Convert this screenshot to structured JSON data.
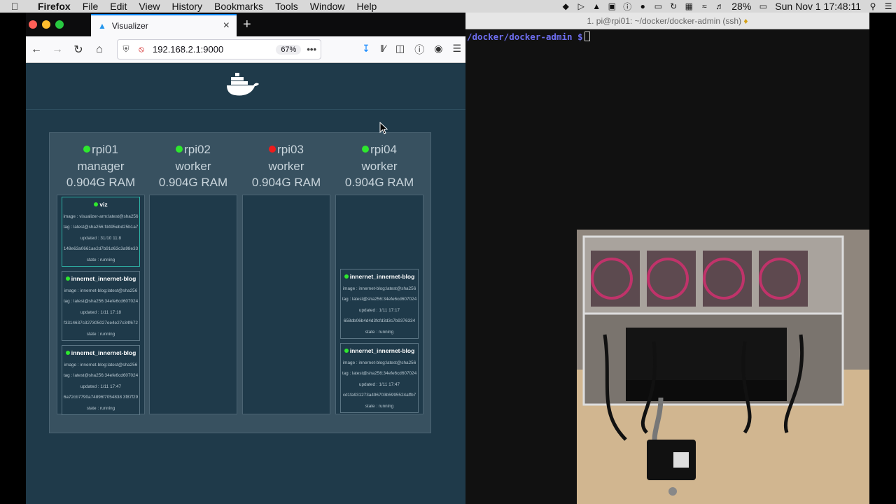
{
  "menubar": {
    "app_name": "Firefox",
    "items": [
      "File",
      "Edit",
      "View",
      "History",
      "Bookmarks",
      "Tools",
      "Window",
      "Help"
    ],
    "battery": "28%",
    "clock": "Sun Nov 1  17:48:11"
  },
  "browser": {
    "tab_title": "Visualizer",
    "url": "192.168.2.1:9000",
    "zoom": "67%"
  },
  "nodes": [
    {
      "name": "rpi01",
      "role": "manager",
      "ram": "0.904G RAM",
      "status": "up",
      "containers": [
        {
          "name": "viz",
          "image": "image : visualizer-arm:latest@sha256",
          "tag": "tag : latest@sha256:fd495ebd25b1a7",
          "updated": "updated : 31/10 11:8",
          "id": "148e63a0661ae2d7b91d63c3a98e33",
          "state": "state : running",
          "highlight": true
        },
        {
          "name": "innernet_innernet-blog",
          "image": "image : innernet-blog:latest@sha256",
          "tag": "tag : latest@sha256:34efe6cd607024",
          "updated": "updated : 1/11 17:18",
          "id": "f3314637c327305027ee4e27c34f672",
          "state": "state : running",
          "highlight": false
        },
        {
          "name": "innernet_innernet-blog",
          "image": "image : innernet-blog:latest@sha256",
          "tag": "tag : latest@sha256:34efe6cd607024",
          "updated": "updated : 1/11 17:47",
          "id": "6a72cb7790a74896f7054838 3f87f29",
          "state": "state : running",
          "highlight": false
        }
      ]
    },
    {
      "name": "rpi02",
      "role": "worker",
      "ram": "0.904G RAM",
      "status": "up",
      "containers": []
    },
    {
      "name": "rpi03",
      "role": "worker",
      "ram": "0.904G RAM",
      "status": "down",
      "containers": []
    },
    {
      "name": "rpi04",
      "role": "worker",
      "ram": "0.904G RAM",
      "status": "up",
      "containers": [
        {
          "name": "innernet_innernet-blog",
          "image": "image : innernet-blog:latest@sha256",
          "tag": "tag : latest@sha256:34efe6cd607024",
          "updated": "updated : 1/11 17:17",
          "id": "658db06b4d4d3fcfd3d3c7b9376334",
          "state": "state : running",
          "highlight": false
        },
        {
          "name": "innernet_innernet-blog",
          "image": "image : innernet-blog:latest@sha256",
          "tag": "tag : latest@sha256:34efe6cd607024",
          "updated": "updated : 1/11 17:47",
          "id": "cd1fa931273a496703b5995524affb7",
          "state": "state : running",
          "highlight": false
        }
      ]
    }
  ],
  "terminal": {
    "title": "1. pi@rpi01: ~/docker/docker-admin (ssh)",
    "prompt": "/docker/docker-admin $"
  },
  "colors": {
    "page_bg": "#1f3a4a",
    "node_up": "#2ee72e",
    "node_down": "#ee1c1c",
    "accent": "#2fb3a6"
  }
}
